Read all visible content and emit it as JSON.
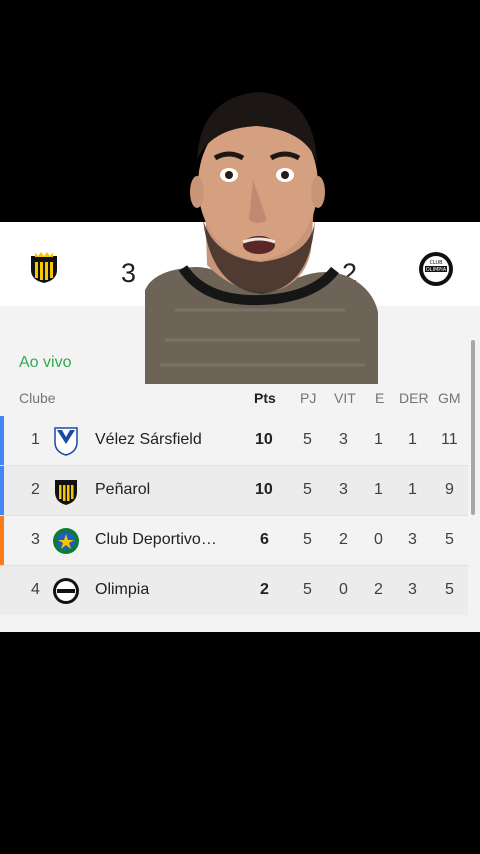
{
  "match": {
    "home": {
      "crest": "penarol-crest",
      "score": "3"
    },
    "away": {
      "crest": "olimpia-crest",
      "score": "2"
    }
  },
  "standings": {
    "status": "Ao vivo",
    "headers": {
      "club": "Clube",
      "pts": "Pts",
      "pj": "PJ",
      "vit": "VIT",
      "e": "E",
      "der": "DER",
      "gm": "GM"
    },
    "rows": [
      {
        "pos": "1",
        "name": "Vélez Sársfield",
        "crest": "velez-crest",
        "pts": "10",
        "pj": "5",
        "vit": "3",
        "e": "1",
        "der": "1",
        "gm": "11",
        "marker": "#4285f4"
      },
      {
        "pos": "2",
        "name": "Peñarol",
        "crest": "penarol-crest",
        "pts": "10",
        "pj": "5",
        "vit": "3",
        "e": "1",
        "der": "1",
        "gm": "9",
        "marker": "#4285f4"
      },
      {
        "pos": "3",
        "name": "Club Deportivo Guaraní",
        "crest": "guarani-crest",
        "pts": "6",
        "pj": "5",
        "vit": "2",
        "e": "0",
        "der": "3",
        "gm": "5",
        "marker": "#fa7b17"
      },
      {
        "pos": "4",
        "name": "Olimpia",
        "crest": "olimpia-crest",
        "pts": "2",
        "pj": "5",
        "vit": "0",
        "e": "2",
        "der": "3",
        "gm": "5",
        "marker": ""
      }
    ]
  },
  "overlay": {
    "type": "presenter-video",
    "icon": "person-video-overlay"
  },
  "colors": {
    "live": "#34a853",
    "qualify": "#4285f4",
    "playoff": "#fa7b17"
  }
}
